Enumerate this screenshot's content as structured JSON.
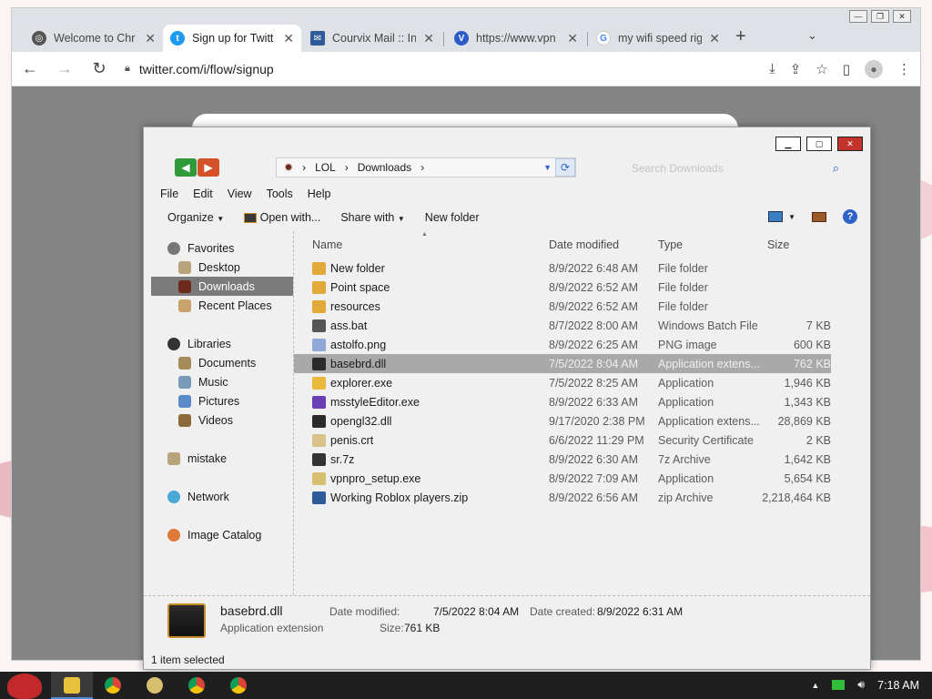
{
  "browser": {
    "tabs": [
      {
        "label": "Welcome to Chr",
        "icon": "globe-icon",
        "color": "#555555"
      },
      {
        "label": "Sign up for Twitt",
        "icon": "twitter-icon",
        "color": "#1d9bf0",
        "active": true
      },
      {
        "label": "Courvix Mail :: In",
        "icon": "mail-icon",
        "color": "#2e5b9a"
      },
      {
        "label": "https://www.vpn",
        "icon": "vpn-icon",
        "color": "#2b5cc8"
      },
      {
        "label": "my wifi speed rig",
        "icon": "google-icon",
        "color": "#4285f4"
      }
    ],
    "url": "twitter.com/i/flow/signup"
  },
  "explorer": {
    "breadcrumb": [
      "LOL",
      "Downloads"
    ],
    "search_placeholder": "Search Downloads",
    "menu": [
      "File",
      "Edit",
      "View",
      "Tools",
      "Help"
    ],
    "toolbar": {
      "organize": "Organize",
      "open_with": "Open with...",
      "share_with": "Share with",
      "new_folder": "New folder"
    },
    "nav": {
      "favorites": "Favorites",
      "desktop": "Desktop",
      "downloads": "Downloads",
      "recent": "Recent Places",
      "libraries": "Libraries",
      "documents": "Documents",
      "music": "Music",
      "pictures": "Pictures",
      "videos": "Videos",
      "mistake": "mistake",
      "network": "Network",
      "image_catalog": "Image Catalog"
    },
    "columns": {
      "name": "Name",
      "date": "Date modified",
      "type": "Type",
      "size": "Size"
    },
    "files": [
      {
        "name": "New folder",
        "date": "8/9/2022 6:48 AM",
        "type": "File folder",
        "size": "",
        "icon": "folder-icon",
        "color": "#e0a93a"
      },
      {
        "name": "Point space",
        "date": "8/9/2022 6:52 AM",
        "type": "File folder",
        "size": "",
        "icon": "folder-icon",
        "color": "#e0a93a"
      },
      {
        "name": "resources",
        "date": "8/9/2022 6:52 AM",
        "type": "File folder",
        "size": "",
        "icon": "folder-icon",
        "color": "#e0a93a"
      },
      {
        "name": "ass.bat",
        "date": "8/7/2022 8:00 AM",
        "type": "Windows Batch File",
        "size": "7 KB",
        "icon": "batch-file-icon",
        "color": "#555555"
      },
      {
        "name": "astolfo.png",
        "date": "8/9/2022 6:25 AM",
        "type": "PNG image",
        "size": "600 KB",
        "icon": "image-file-icon",
        "color": "#8fa8d8"
      },
      {
        "name": "basebrd.dll",
        "date": "7/5/2022 8:04 AM",
        "type": "Application extens...",
        "size": "762 KB",
        "icon": "dll-file-icon",
        "color": "#2b2b2b",
        "selected": true
      },
      {
        "name": "explorer.exe",
        "date": "7/5/2022 8:25 AM",
        "type": "Application",
        "size": "1,946 KB",
        "icon": "folder-app-icon",
        "color": "#e8b93a"
      },
      {
        "name": "msstyleEditor.exe",
        "date": "8/9/2022 6:33 AM",
        "type": "Application",
        "size": "1,343 KB",
        "icon": "app-icon",
        "color": "#6a3fb5"
      },
      {
        "name": "opengl32.dll",
        "date": "9/17/2020 2:38 PM",
        "type": "Application extens...",
        "size": "28,869 KB",
        "icon": "dll-file-icon",
        "color": "#2b2b2b"
      },
      {
        "name": "penis.crt",
        "date": "6/6/2022 11:29 PM",
        "type": "Security Certificate",
        "size": "2 KB",
        "icon": "certificate-icon",
        "color": "#d9c38a"
      },
      {
        "name": "sr.7z",
        "date": "8/9/2022 6:30 AM",
        "type": "7z Archive",
        "size": "1,642 KB",
        "icon": "archive-icon",
        "color": "#333333"
      },
      {
        "name": "vpnpro_setup.exe",
        "date": "8/9/2022 7:09 AM",
        "type": "Application",
        "size": "5,654 KB",
        "icon": "installer-icon",
        "color": "#d6c070"
      },
      {
        "name": "Working Roblox players.zip",
        "date": "8/9/2022 6:56 AM",
        "type": "zip Archive",
        "size": "2,218,464 KB",
        "icon": "archive-icon",
        "color": "#2e5b9a"
      }
    ],
    "details": {
      "name": "basebrd.dll",
      "type": "Application extension",
      "date_modified_label": "Date modified:",
      "date_modified": "7/5/2022 8:04 AM",
      "date_created_label": "Date created:",
      "date_created": "8/9/2022 6:31 AM",
      "size_label": "Size:",
      "size": "761 KB"
    },
    "status": "1 item selected"
  },
  "taskbar": {
    "time": "7:18 AM"
  }
}
